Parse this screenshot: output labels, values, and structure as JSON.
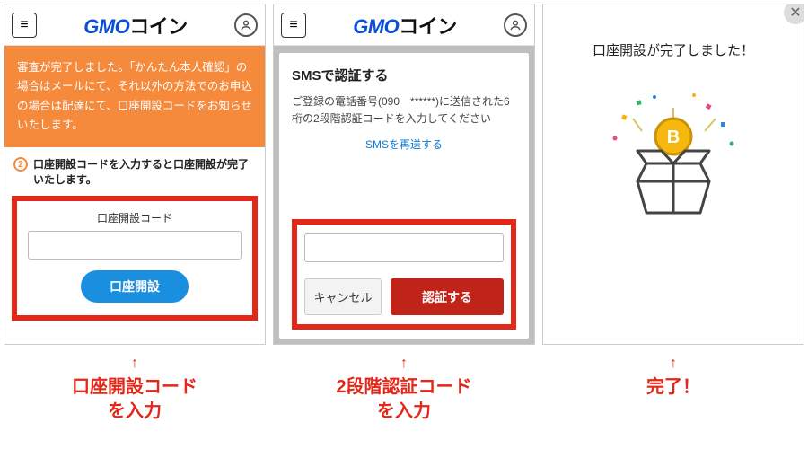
{
  "header": {
    "logo_gmo": "GMO",
    "logo_coin": "コイン"
  },
  "panel1": {
    "notice": "審査が完了しました。「かんたん本人確認」の場合はメールにて、それ以外の方法でのお申込の場合は配達にて、口座開設コードをお知らせいたします。",
    "step_num": "2",
    "step_text": "口座開設コードを入力すると口座開設が完了いたします。",
    "field_label": "口座開設コード",
    "button": "口座開設"
  },
  "panel2": {
    "modal_title": "SMSで認証する",
    "modal_desc": "ご登録の電話番号(090　******)に送信された6桁の2段階認証コードを入力してください",
    "resend": "SMSを再送する",
    "cancel": "キャンセル",
    "confirm": "認証する"
  },
  "panel3": {
    "complete": "口座開設が完了しました！"
  },
  "captions": {
    "arrow": "↑",
    "c1": "口座開設コード\nを入力",
    "c2": "2段階認証コード\nを入力",
    "c3": "完了！"
  }
}
